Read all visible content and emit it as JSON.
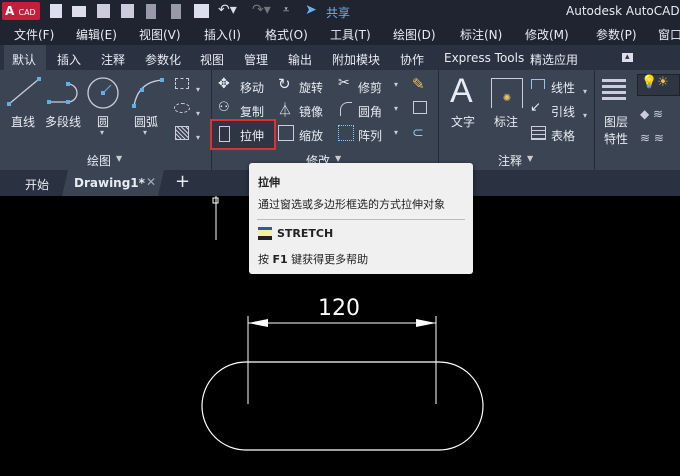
{
  "title": {
    "logo": "A",
    "logo_sub": "CAD",
    "share": "共享",
    "app_title": "Autodesk AutoCAD"
  },
  "menu": [
    "文件(F)",
    "编辑(E)",
    "视图(V)",
    "插入(I)",
    "格式(O)",
    "工具(T)",
    "绘图(D)",
    "标注(N)",
    "修改(M)",
    "参数(P)",
    "窗口("
  ],
  "ribbon_tabs": [
    "默认",
    "插入",
    "注释",
    "参数化",
    "视图",
    "管理",
    "输出",
    "附加模块",
    "协作",
    "Express Tools",
    "精选应用"
  ],
  "draw": {
    "items": [
      "直线",
      "多段线",
      "圆",
      "圆弧"
    ],
    "panel": "绘图"
  },
  "modify": {
    "items": [
      "移动",
      "旋转",
      "修剪",
      "复制",
      "镜像",
      "圆角",
      "拉伸",
      "缩放",
      "阵列"
    ],
    "panel": "修改"
  },
  "annotation": {
    "text": "文字",
    "dim": "标注",
    "linear": "线性",
    "leader": "引线",
    "table": "表格",
    "panel": "注释"
  },
  "layers": {
    "label1": "图层",
    "label2": "特性"
  },
  "file_tabs": {
    "start": "开始",
    "drawing": "Drawing1*"
  },
  "tooltip": {
    "title": "拉伸",
    "desc": "通过窗选或多边形框选的方式拉伸对象",
    "command": "STRETCH",
    "help_pre": "按",
    "help_key": "F1",
    "help_post": "键获得更多帮助"
  },
  "drawing": {
    "dimension": "120"
  }
}
